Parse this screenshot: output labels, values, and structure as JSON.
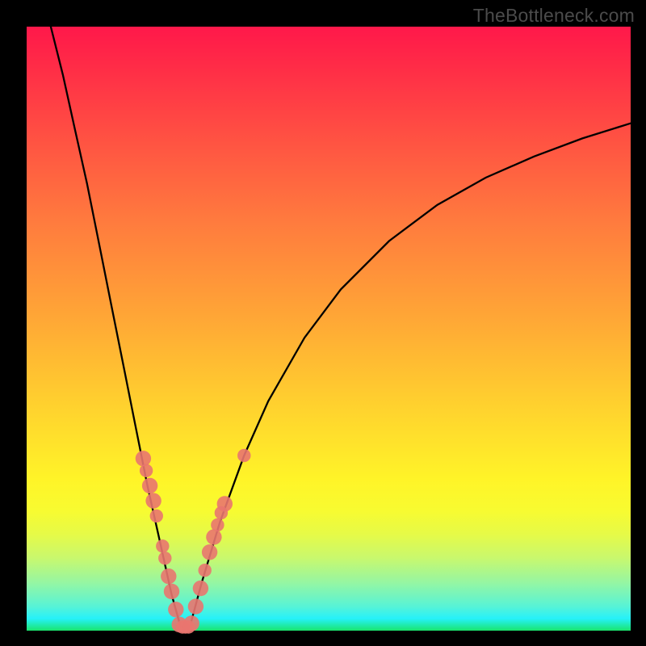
{
  "watermark": "TheBottleneck.com",
  "chart_data": {
    "type": "line",
    "title": "",
    "xlabel": "",
    "ylabel": "",
    "xlim": [
      0,
      100
    ],
    "ylim": [
      0,
      100
    ],
    "grid": false,
    "legend": false,
    "curve": {
      "description": "V-shaped bottleneck curve: steep falling left branch and shallow rising right branch, minimum near x≈26",
      "left": [
        {
          "x": 4.0,
          "y": 100.0
        },
        {
          "x": 6.0,
          "y": 92.0
        },
        {
          "x": 8.0,
          "y": 83.0
        },
        {
          "x": 10.0,
          "y": 74.0
        },
        {
          "x": 12.0,
          "y": 64.0
        },
        {
          "x": 14.0,
          "y": 54.0
        },
        {
          "x": 16.0,
          "y": 44.0
        },
        {
          "x": 18.0,
          "y": 34.0
        },
        {
          "x": 20.0,
          "y": 24.0
        },
        {
          "x": 22.0,
          "y": 15.0
        },
        {
          "x": 24.0,
          "y": 6.0
        },
        {
          "x": 25.5,
          "y": 0.6
        }
      ],
      "right": [
        {
          "x": 27.0,
          "y": 0.6
        },
        {
          "x": 29.0,
          "y": 8.0
        },
        {
          "x": 32.0,
          "y": 18.0
        },
        {
          "x": 36.0,
          "y": 29.0
        },
        {
          "x": 40.0,
          "y": 38.0
        },
        {
          "x": 46.0,
          "y": 48.5
        },
        {
          "x": 52.0,
          "y": 56.5
        },
        {
          "x": 60.0,
          "y": 64.5
        },
        {
          "x": 68.0,
          "y": 70.5
        },
        {
          "x": 76.0,
          "y": 75.0
        },
        {
          "x": 84.0,
          "y": 78.5
        },
        {
          "x": 92.0,
          "y": 81.5
        },
        {
          "x": 100.0,
          "y": 84.0
        }
      ]
    },
    "points": [
      {
        "x": 19.3,
        "y": 28.5,
        "r": 1.3
      },
      {
        "x": 19.8,
        "y": 26.5,
        "r": 1.1
      },
      {
        "x": 20.4,
        "y": 24.0,
        "r": 1.3
      },
      {
        "x": 21.0,
        "y": 21.5,
        "r": 1.3
      },
      {
        "x": 21.5,
        "y": 19.0,
        "r": 1.1
      },
      {
        "x": 22.5,
        "y": 14.0,
        "r": 1.1
      },
      {
        "x": 22.9,
        "y": 12.0,
        "r": 1.1
      },
      {
        "x": 23.5,
        "y": 9.0,
        "r": 1.3
      },
      {
        "x": 24.0,
        "y": 6.5,
        "r": 1.3
      },
      {
        "x": 24.7,
        "y": 3.5,
        "r": 1.3
      },
      {
        "x": 25.3,
        "y": 1.0,
        "r": 1.3
      },
      {
        "x": 25.8,
        "y": 0.6,
        "r": 1.1
      },
      {
        "x": 26.3,
        "y": 0.6,
        "r": 1.1
      },
      {
        "x": 26.8,
        "y": 0.6,
        "r": 1.1
      },
      {
        "x": 27.3,
        "y": 1.2,
        "r": 1.3
      },
      {
        "x": 28.0,
        "y": 4.0,
        "r": 1.3
      },
      {
        "x": 28.8,
        "y": 7.0,
        "r": 1.3
      },
      {
        "x": 29.5,
        "y": 10.0,
        "r": 1.1
      },
      {
        "x": 30.3,
        "y": 13.0,
        "r": 1.3
      },
      {
        "x": 31.0,
        "y": 15.5,
        "r": 1.3
      },
      {
        "x": 31.6,
        "y": 17.5,
        "r": 1.1
      },
      {
        "x": 32.2,
        "y": 19.5,
        "r": 1.1
      },
      {
        "x": 32.8,
        "y": 21.0,
        "r": 1.3
      },
      {
        "x": 36.0,
        "y": 29.0,
        "r": 1.1
      }
    ]
  }
}
